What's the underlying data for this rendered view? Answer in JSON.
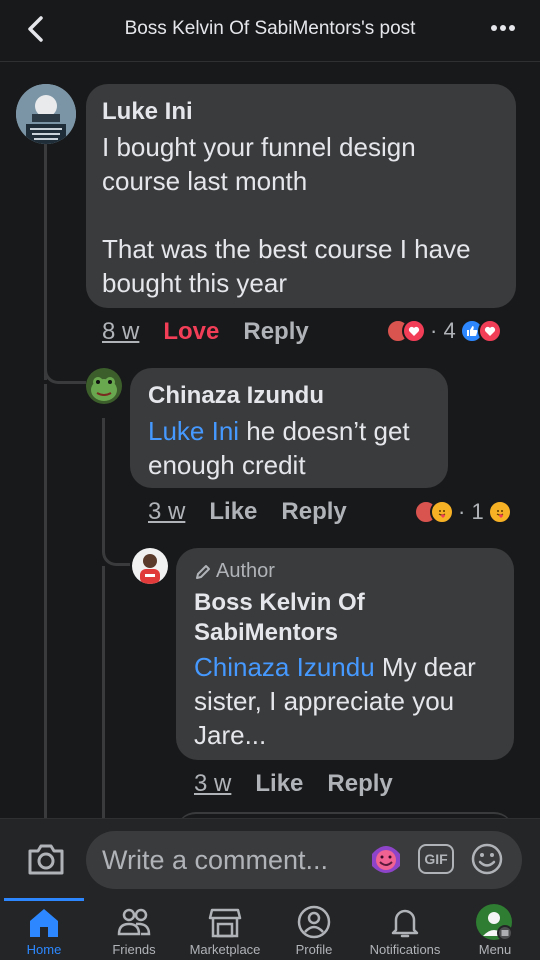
{
  "header": {
    "title": "Boss Kelvin Of SabiMentors's post"
  },
  "comments": [
    {
      "author": "Luke Ini",
      "text": "I bought your funnel design\ncourse  last month\n\nThat was the best course I have\nbought this year",
      "time": "8 w",
      "reaction_action": "Love",
      "reply": "Reply",
      "reaction_count": "· 4"
    },
    {
      "author": "Chinaza Izundu",
      "mention": "Luke Ini",
      "text": " he doesn’t get\nenough credit",
      "time": "3 w",
      "like": "Like",
      "reply": "Reply",
      "reaction_count": "· 1"
    },
    {
      "badge": "Author",
      "author_line1": "Boss Kelvin Of",
      "author_line2": "SabiMentors",
      "mention": "Chinaza Izundu",
      "text": " My dear\nsister, I appreciate you\nJare...",
      "time": "3 w",
      "like": "Like",
      "reply": "Reply"
    }
  ],
  "composer": {
    "placeholder": "Write a comment...",
    "gif": "GIF"
  },
  "tabs": [
    {
      "label": "Home",
      "icon": "home-icon"
    },
    {
      "label": "Friends",
      "icon": "friends-icon"
    },
    {
      "label": "Marketplace",
      "icon": "marketplace-icon"
    },
    {
      "label": "Profile",
      "icon": "profile-icon"
    },
    {
      "label": "Notifications",
      "icon": "bell-icon"
    },
    {
      "label": "Menu",
      "icon": "menu-icon"
    }
  ],
  "colors": {
    "accent": "#2d88ff",
    "love": "#f33e58",
    "mention": "#4599ff",
    "bubble": "#3a3b3c",
    "background": "#18191a"
  }
}
